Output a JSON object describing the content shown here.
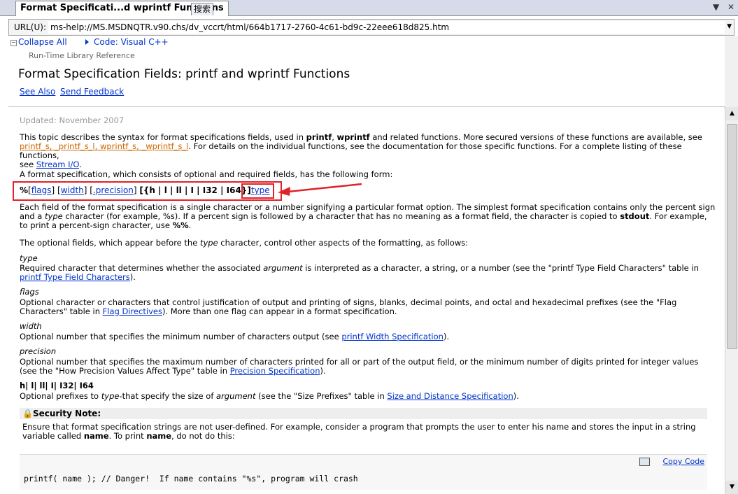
{
  "tabs": {
    "active": "Format Specificati...d wprintf Functions",
    "other": "搜索",
    "dropdown_icon": "▼",
    "close_icon": "✕"
  },
  "url": {
    "label": "URL(U):",
    "value": "ms-help://MS.MSDNQTR.v90.chs/dv_vccrt/html/664b1717-2760-4c61-bd9c-22eee618d825.htm"
  },
  "header": {
    "collapse_all": "Collapse All",
    "code_lang": "Code: Visual C++",
    "library": "Run-Time Library Reference",
    "title": "Format Specification Fields: printf and wprintf Functions",
    "see_also": "See Also",
    "send_feedback": "Send Feedback"
  },
  "content": {
    "updated": "Updated: November 2007",
    "intro_1": "This topic describes the syntax for format specifications fields, used in ",
    "printf": "printf",
    "comma": ", ",
    "wprintf": "wprintf",
    "intro_2": " and related functions. More secured versions of these functions are available, see",
    "secure_links": "printf_s, _printf_s_l, wprintf_s, _wprintf_s_l",
    "intro_3": ". For details on the individual functions, see the documentation for those specific functions. For a complete listing of these functions,",
    "intro_see": "see ",
    "stream_io": "Stream I/O",
    "period": ".",
    "form_intro": "A format specification, which consists of optional and required fields, has the following form:",
    "syntax": {
      "percent": "%",
      "flags": "flags",
      "width": "width",
      "precision": ".precision",
      "sizes": "[{h | l | ll | I | I32 | I64}]",
      "type": "type"
    },
    "each_field_1": "Each field of the format specification is a single character or a number signifying a particular format option. The simplest format specification contains only the percent sign",
    "each_field_2a": "and a ",
    "each_field_type": "type",
    "each_field_2b": " character (for example, %s). If a percent sign is followed by a character that has no meaning as a format field, the character is copied to ",
    "stdout": "stdout",
    "each_field_2c": ". For example,",
    "each_field_3a": "to print a percent-sign character, use ",
    "percent_percent": "%%",
    "optional_a": "The optional fields, which appear before the ",
    "optional_type": "type",
    "optional_b": " character, control other aspects of the formatting, as follows:",
    "fields": {
      "type_term": "type",
      "type_desc_a": "Required character that determines whether the associated ",
      "type_arg": "argument",
      "type_desc_b": " is interpreted as a character, a string, or a number (see the \"printf Type Field Characters\" table in",
      "type_link": "printf Type Field Characters",
      "type_end": ").",
      "flags_term": "flags",
      "flags_desc": "Optional character or characters that control justification of output and printing of signs, blanks, decimal points, and octal and hexadecimal prefixes (see the \"Flag",
      "flags_desc_b": "Characters\" table in ",
      "flags_link": "Flag Directives",
      "flags_end": "). More than one flag can appear in a format specification.",
      "width_term": "width",
      "width_desc": "Optional number that specifies the minimum number of characters output (see ",
      "width_link": "printf Width Specification",
      "width_end": ").",
      "precision_term": "precision",
      "precision_desc": "Optional number that specifies the maximum number of characters printed for all or part of the output field, or the minimum number of digits printed for integer values",
      "precision_desc_b": "(see the \"How Precision Values Affect Type\" table in ",
      "precision_link": "Precision Specification",
      "precision_end": ").",
      "size_term": "h| l| ll| I| I32| I64",
      "size_desc_a": "Optional prefixes to ",
      "size_type": "type",
      "size_desc_b": "-that specify the size of ",
      "size_arg": "argument",
      "size_desc_c": " (see the \"Size Prefixes\" table in ",
      "size_link": "Size and Distance Specification",
      "size_end": ")."
    },
    "security": {
      "title": "Security Note:",
      "text_1": "Ensure that format specification strings are not user-defined. For example, consider a program that prompts the user to enter his name and stores the input in a string",
      "text_2a": "variable called ",
      "name": "name",
      "text_2b": ". To print ",
      "text_2c": ", do not do this:"
    },
    "code": {
      "copy": "Copy Code",
      "line": "printf( name ); // Danger!  If name contains \"%s\", program will crash"
    }
  },
  "annotation_color": "#e0222a"
}
